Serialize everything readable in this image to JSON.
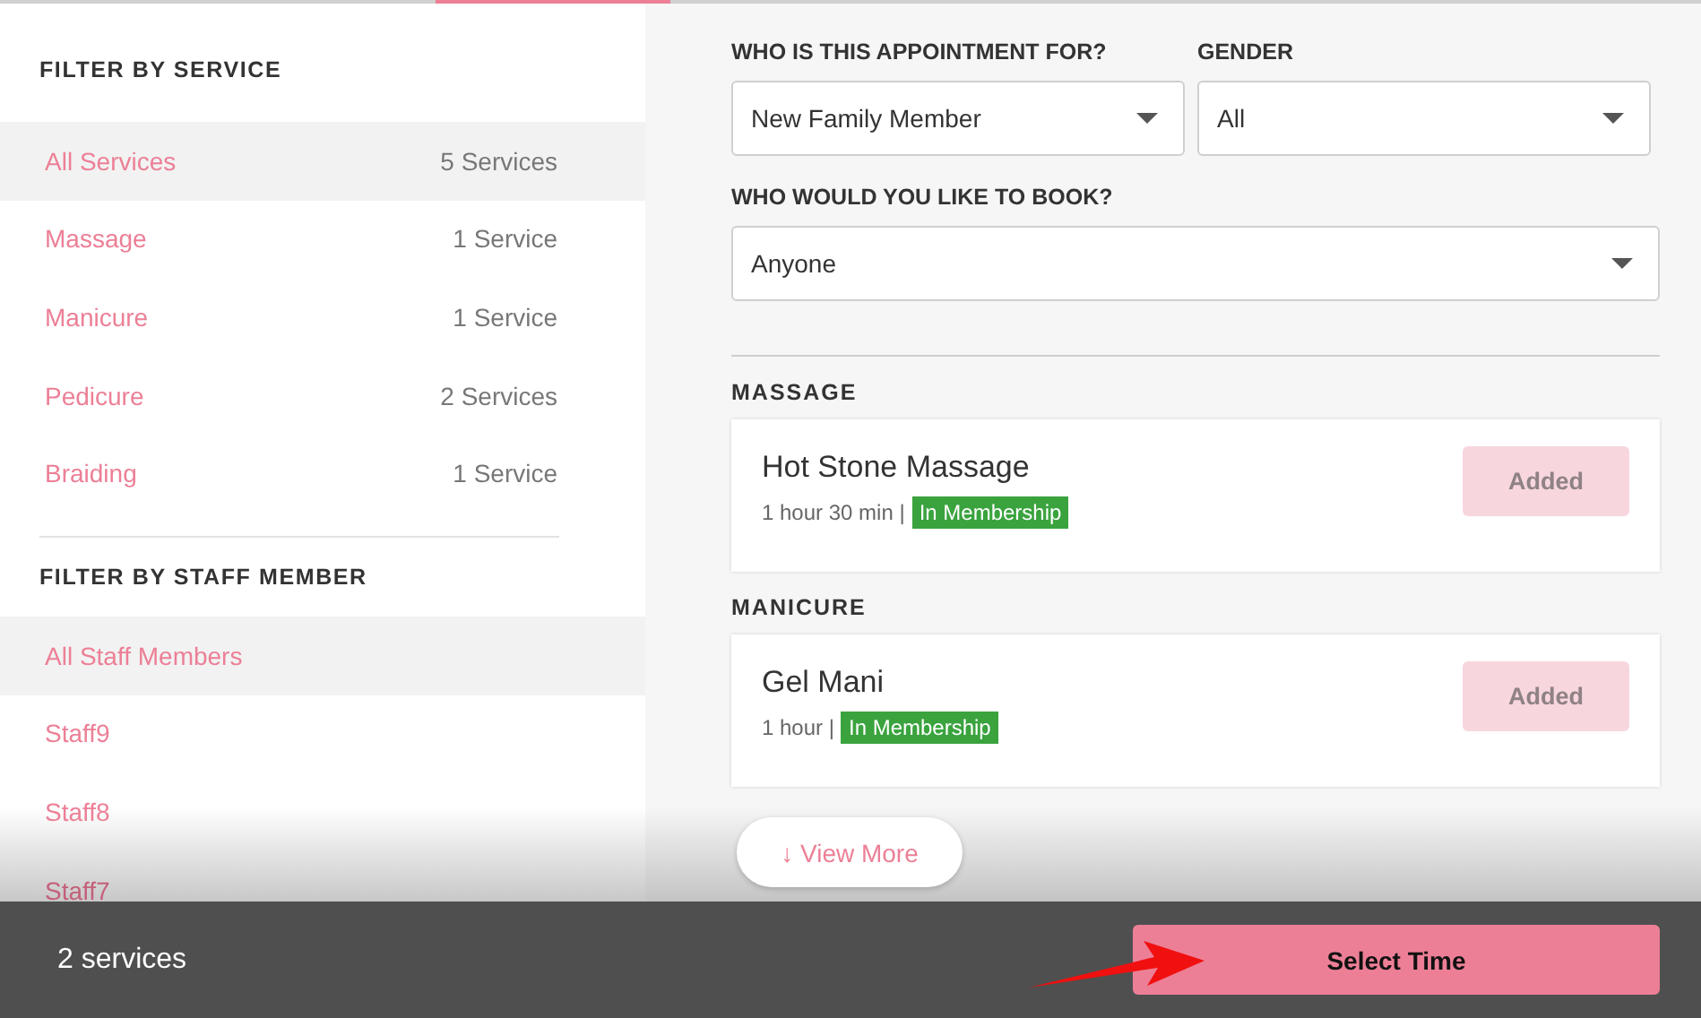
{
  "service_filter": {
    "title": "FILTER BY SERVICE",
    "items": [
      {
        "label": "All Services",
        "count": "5 Services",
        "selected": true
      },
      {
        "label": "Massage",
        "count": "1 Service",
        "selected": false
      },
      {
        "label": "Manicure",
        "count": "1 Service",
        "selected": false
      },
      {
        "label": "Pedicure",
        "count": "2 Services",
        "selected": false
      },
      {
        "label": "Braiding",
        "count": "1 Service",
        "selected": false
      }
    ]
  },
  "staff_filter": {
    "title": "FILTER BY STAFF MEMBER",
    "items": [
      {
        "label": "All Staff Members",
        "selected": true
      },
      {
        "label": "Staff9",
        "selected": false
      },
      {
        "label": "Staff8",
        "selected": false
      },
      {
        "label": "Staff7",
        "selected": false
      }
    ]
  },
  "appointment_for": {
    "label": "WHO IS THIS APPOINTMENT FOR?",
    "value": "New Family Member"
  },
  "gender": {
    "label": "GENDER",
    "value": "All"
  },
  "book_with": {
    "label": "WHO WOULD YOU LIKE TO BOOK?",
    "value": "Anyone"
  },
  "sections": [
    {
      "title": "MASSAGE",
      "services": [
        {
          "name": "Hot Stone Massage",
          "duration": "1 hour 30 min |",
          "badge": "In Membership",
          "button": "Added",
          "added": true
        }
      ]
    },
    {
      "title": "MANICURE",
      "services": [
        {
          "name": "Gel Mani",
          "duration": "1 hour |",
          "badge": "In Membership",
          "button": "Added",
          "added": true
        }
      ]
    }
  ],
  "view_more": "↓ View More",
  "footer": {
    "summary": "2 services",
    "button": "Select Time"
  }
}
